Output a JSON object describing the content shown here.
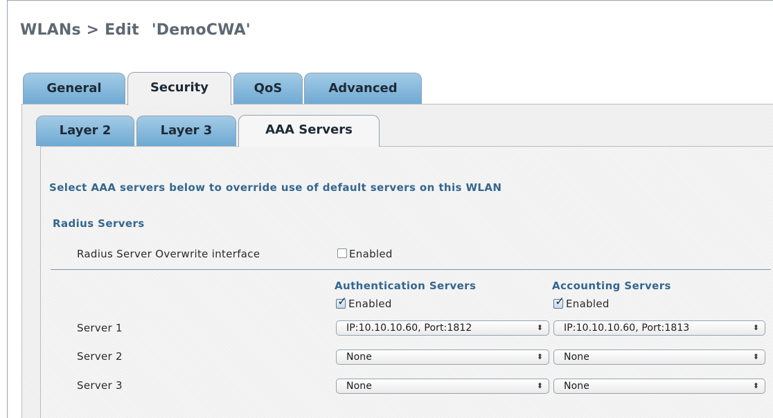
{
  "breadcrumb": {
    "path": "WLANs > Edit",
    "wlan_name": "'DemoCWA'"
  },
  "main_tabs": [
    {
      "label": "General",
      "active": false
    },
    {
      "label": "Security",
      "active": true
    },
    {
      "label": "QoS",
      "active": false
    },
    {
      "label": "Advanced",
      "active": false
    }
  ],
  "sub_tabs": [
    {
      "label": "Layer 2",
      "active": false
    },
    {
      "label": "Layer 3",
      "active": false
    },
    {
      "label": "AAA Servers",
      "active": true
    }
  ],
  "aaa": {
    "intro": "Select AAA servers below to override use of default servers on this WLAN",
    "radius_heading": "Radius Servers",
    "overwrite_label": "Radius Server Overwrite interface",
    "overwrite_enabled_label": "Enabled",
    "overwrite_enabled": false,
    "auth_header": "Authentication Servers",
    "acct_header": "Accounting Servers",
    "auth_enabled_label": "Enabled",
    "auth_enabled": true,
    "acct_enabled_label": "Enabled",
    "acct_enabled": true,
    "servers": [
      {
        "label": "Server 1",
        "auth": "IP:10.10.10.60, Port:1812",
        "acct": "IP:10.10.10.60, Port:1813"
      },
      {
        "label": "Server 2",
        "auth": "None",
        "acct": "None"
      },
      {
        "label": "Server 3",
        "auth": "None",
        "acct": "None"
      }
    ]
  },
  "icons": {
    "select_arrows": "up-down-arrows-icon",
    "checkmark": "checkmark-icon"
  },
  "colors": {
    "tab_gradient_top": "#a3cbe6",
    "tab_gradient_bottom": "#6ea9d3",
    "heading_blue": "#34668e"
  }
}
